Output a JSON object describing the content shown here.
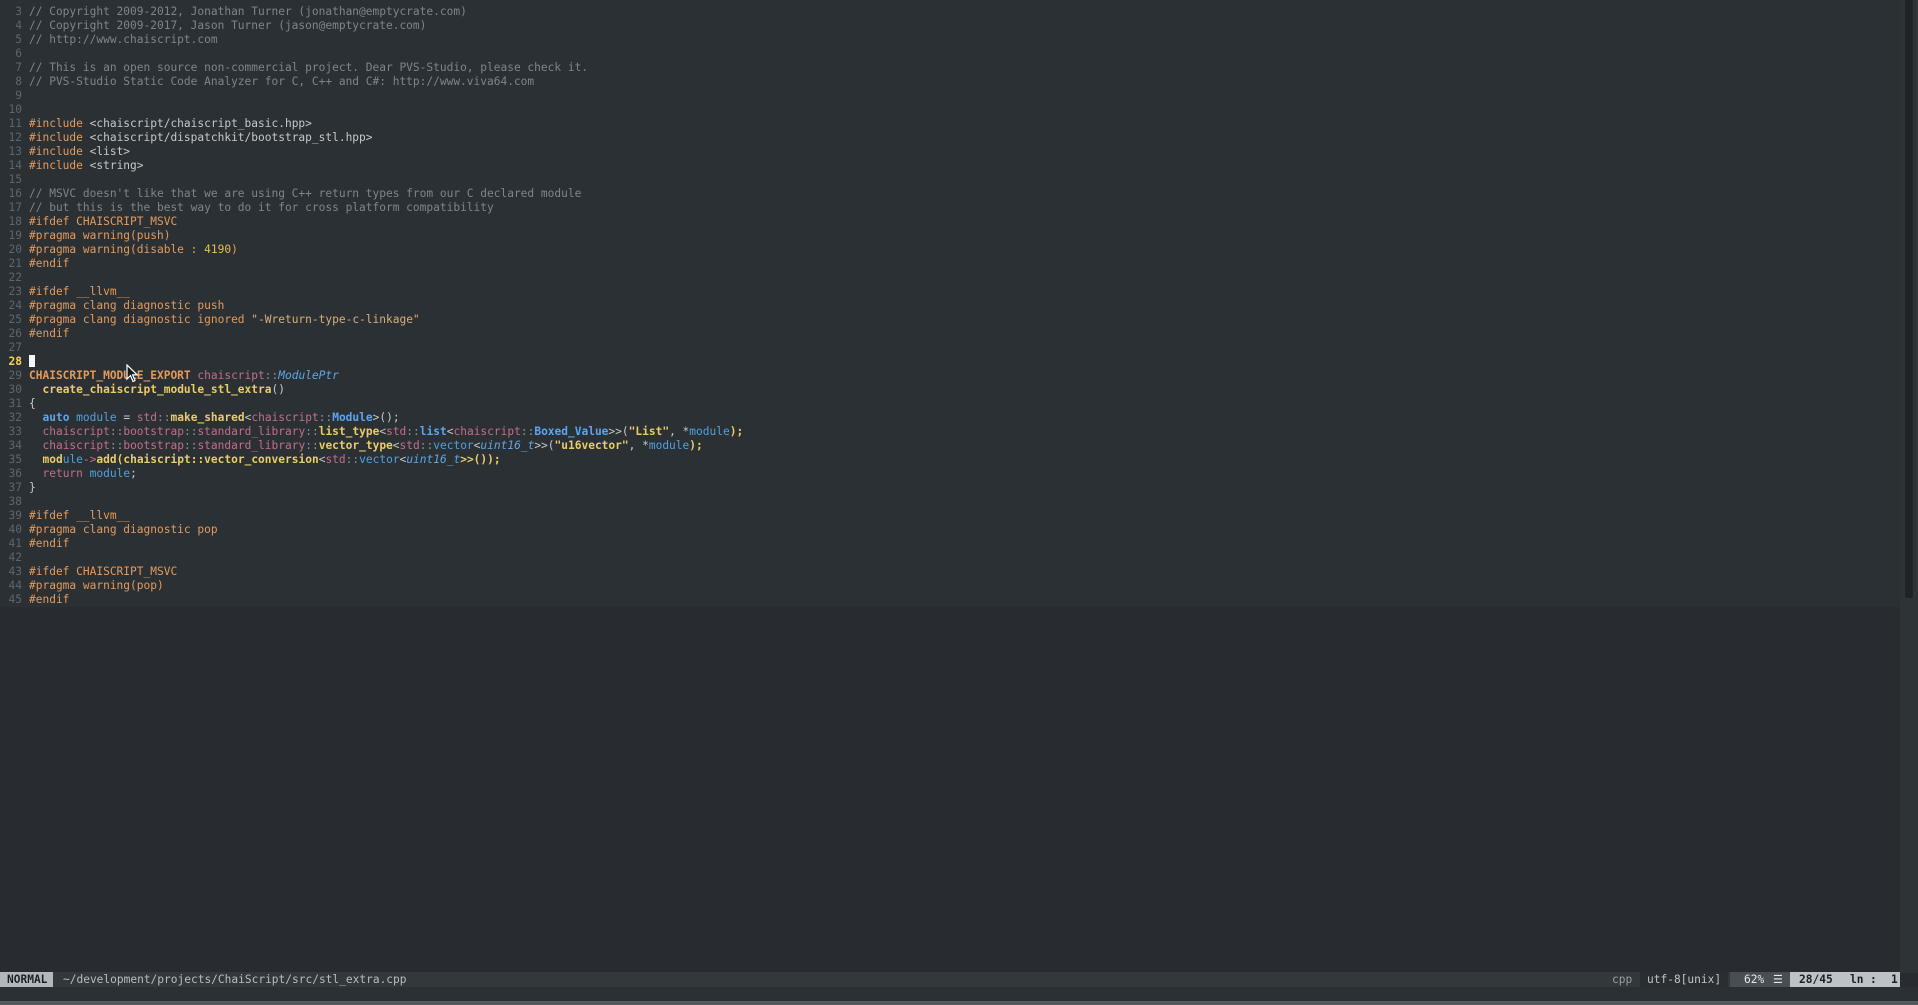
{
  "editor": {
    "lines": [
      {
        "n": "3",
        "tokens": [
          {
            "t": "// Copyright 2009-2012, Jonathan Turner (jonathan@emptycrate.com)",
            "c": "comment"
          }
        ]
      },
      {
        "n": "4",
        "tokens": [
          {
            "t": "// Copyright 2009-2017, Jason Turner (jason@emptycrate.com)",
            "c": "comment"
          }
        ]
      },
      {
        "n": "5",
        "tokens": [
          {
            "t": "// http://www.chaiscript.com",
            "c": "comment"
          }
        ]
      },
      {
        "n": "6",
        "tokens": []
      },
      {
        "n": "7",
        "tokens": [
          {
            "t": "// This is an open source non-commercial project. Dear PVS-Studio, please check it.",
            "c": "comment"
          }
        ]
      },
      {
        "n": "8",
        "tokens": [
          {
            "t": "// PVS-Studio Static Code Analyzer for C, C++ and C#: http://www.viva64.com",
            "c": "comment"
          }
        ]
      },
      {
        "n": "9",
        "tokens": []
      },
      {
        "n": "10",
        "tokens": []
      },
      {
        "n": "11",
        "tokens": [
          {
            "t": "#include ",
            "c": "pp"
          },
          {
            "t": "<chaiscript/chaiscript_basic.hpp>",
            "c": "plain"
          }
        ]
      },
      {
        "n": "12",
        "tokens": [
          {
            "t": "#include ",
            "c": "pp"
          },
          {
            "t": "<chaiscript/dispatchkit/bootstrap_stl.hpp>",
            "c": "plain"
          }
        ]
      },
      {
        "n": "13",
        "tokens": [
          {
            "t": "#include ",
            "c": "pp"
          },
          {
            "t": "<list>",
            "c": "plain"
          }
        ]
      },
      {
        "n": "14",
        "tokens": [
          {
            "t": "#include ",
            "c": "pp"
          },
          {
            "t": "<string>",
            "c": "plain"
          }
        ]
      },
      {
        "n": "15",
        "tokens": []
      },
      {
        "n": "16",
        "tokens": [
          {
            "t": "// MSVC doesn't like that we are using C++ return types from our C declared module",
            "c": "comment"
          }
        ]
      },
      {
        "n": "17",
        "tokens": [
          {
            "t": "// but this is the best way to do it for cross platform compatibility",
            "c": "comment"
          }
        ]
      },
      {
        "n": "18",
        "tokens": [
          {
            "t": "#ifdef CHAISCRIPT_MSVC",
            "c": "pp"
          }
        ]
      },
      {
        "n": "19",
        "tokens": [
          {
            "t": "#pragma warning(push)",
            "c": "pp"
          }
        ]
      },
      {
        "n": "20",
        "tokens": [
          {
            "t": "#pragma warning(disable : ",
            "c": "pp"
          },
          {
            "t": "4190",
            "c": "num"
          },
          {
            "t": ")",
            "c": "pp"
          }
        ]
      },
      {
        "n": "21",
        "tokens": [
          {
            "t": "#endif",
            "c": "pp"
          }
        ]
      },
      {
        "n": "22",
        "tokens": []
      },
      {
        "n": "23",
        "tokens": [
          {
            "t": "#ifdef __llvm__",
            "c": "pp"
          }
        ]
      },
      {
        "n": "24",
        "tokens": [
          {
            "t": "#pragma clang diagnostic push",
            "c": "pp"
          }
        ]
      },
      {
        "n": "25",
        "tokens": [
          {
            "t": "#pragma clang diagnostic ignored ",
            "c": "pp"
          },
          {
            "t": "\"-Wreturn-type-c-linkage\"",
            "c": "str"
          }
        ]
      },
      {
        "n": "26",
        "tokens": [
          {
            "t": "#endif",
            "c": "pp"
          }
        ]
      },
      {
        "n": "27",
        "tokens": []
      },
      {
        "n": "28",
        "current": true,
        "tokens": []
      },
      {
        "n": "29",
        "tokens": [
          {
            "t": "CHAISCRIPT_MODULE_EXPORT ",
            "c": "macro"
          },
          {
            "t": "chaiscript",
            "c": "ns"
          },
          {
            "t": "::",
            "c": "sep"
          },
          {
            "t": "ModulePtr",
            "c": "type"
          }
        ]
      },
      {
        "n": "30",
        "tokens": [
          {
            "t": "  ",
            "c": "plain"
          },
          {
            "t": "create_chaiscript_module_stl_extra",
            "c": "fn"
          },
          {
            "t": "()",
            "c": "plain"
          }
        ]
      },
      {
        "n": "31",
        "tokens": [
          {
            "t": "{",
            "c": "plain"
          }
        ]
      },
      {
        "n": "32",
        "tokens": [
          {
            "t": "  ",
            "c": "plain"
          },
          {
            "t": "auto",
            "c": "kw"
          },
          {
            "t": " module",
            "c": "var"
          },
          {
            "t": " = ",
            "c": "plain"
          },
          {
            "t": "std",
            "c": "ns"
          },
          {
            "t": "::",
            "c": "sep"
          },
          {
            "t": "make_shared",
            "c": "fn"
          },
          {
            "t": "<",
            "c": "plain"
          },
          {
            "t": "chaiscript",
            "c": "ns"
          },
          {
            "t": "::",
            "c": "sep"
          },
          {
            "t": "Module",
            "c": "kw"
          },
          {
            "t": ">();",
            "c": "plain"
          }
        ]
      },
      {
        "n": "33",
        "tokens": [
          {
            "t": "  ",
            "c": "plain"
          },
          {
            "t": "chaiscript",
            "c": "ns"
          },
          {
            "t": "::",
            "c": "sep"
          },
          {
            "t": "bootstrap",
            "c": "ns"
          },
          {
            "t": "::",
            "c": "sep"
          },
          {
            "t": "standard_library",
            "c": "ns"
          },
          {
            "t": "::",
            "c": "sep"
          },
          {
            "t": "list_type",
            "c": "fn"
          },
          {
            "t": "<",
            "c": "plain"
          },
          {
            "t": "std",
            "c": "ns"
          },
          {
            "t": "::",
            "c": "sep"
          },
          {
            "t": "list",
            "c": "kw"
          },
          {
            "t": "<",
            "c": "plain"
          },
          {
            "t": "chaiscript",
            "c": "ns"
          },
          {
            "t": "::",
            "c": "sep"
          },
          {
            "t": "Boxed_Value",
            "c": "kw"
          },
          {
            "t": ">>(",
            "c": "plain"
          },
          {
            "t": "\"List\"",
            "c": "fn"
          },
          {
            "t": ", *",
            "c": "plain"
          },
          {
            "t": "module",
            "c": "var"
          },
          {
            "t": ");",
            "c": "fn"
          }
        ]
      },
      {
        "n": "34",
        "tokens": [
          {
            "t": "  ",
            "c": "plain"
          },
          {
            "t": "chaiscript",
            "c": "ns"
          },
          {
            "t": "::",
            "c": "sep"
          },
          {
            "t": "bootstrap",
            "c": "ns"
          },
          {
            "t": "::",
            "c": "sep"
          },
          {
            "t": "standard_library",
            "c": "ns"
          },
          {
            "t": "::",
            "c": "sep"
          },
          {
            "t": "vector_type",
            "c": "fn"
          },
          {
            "t": "<",
            "c": "plain"
          },
          {
            "t": "std",
            "c": "ns"
          },
          {
            "t": "::",
            "c": "sep"
          },
          {
            "t": "vector",
            "c": "var"
          },
          {
            "t": "<",
            "c": "plain"
          },
          {
            "t": "uint16_t",
            "c": "type"
          },
          {
            "t": ">>(",
            "c": "plain"
          },
          {
            "t": "\"u16vector\"",
            "c": "fn"
          },
          {
            "t": ", *",
            "c": "plain"
          },
          {
            "t": "module",
            "c": "var"
          },
          {
            "t": ");",
            "c": "fn"
          }
        ]
      },
      {
        "n": "35",
        "tokens": [
          {
            "t": "  ",
            "c": "plain"
          },
          {
            "t": "mod",
            "c": "fn"
          },
          {
            "t": "ule",
            "c": "var"
          },
          {
            "t": "->",
            "c": "ns"
          },
          {
            "t": "add(chaiscript::vector_conversion",
            "c": "fn"
          },
          {
            "t": "<",
            "c": "plain"
          },
          {
            "t": "std",
            "c": "ns"
          },
          {
            "t": "::",
            "c": "sep"
          },
          {
            "t": "vector",
            "c": "var"
          },
          {
            "t": "<",
            "c": "plain"
          },
          {
            "t": "uint16_t",
            "c": "type"
          },
          {
            "t": ">>());",
            "c": "fn"
          }
        ]
      },
      {
        "n": "36",
        "tokens": [
          {
            "t": "  ",
            "c": "plain"
          },
          {
            "t": "return",
            "c": "ns"
          },
          {
            "t": " module",
            "c": "var"
          },
          {
            "t": ";",
            "c": "plain"
          }
        ]
      },
      {
        "n": "37",
        "tokens": [
          {
            "t": "}",
            "c": "plain"
          }
        ]
      },
      {
        "n": "38",
        "tokens": []
      },
      {
        "n": "39",
        "tokens": [
          {
            "t": "#ifdef __llvm__",
            "c": "pp"
          }
        ]
      },
      {
        "n": "40",
        "tokens": [
          {
            "t": "#pragma clang diagnostic pop",
            "c": "pp"
          }
        ]
      },
      {
        "n": "41",
        "tokens": [
          {
            "t": "#endif",
            "c": "pp"
          }
        ]
      },
      {
        "n": "42",
        "tokens": []
      },
      {
        "n": "43",
        "tokens": [
          {
            "t": "#ifdef CHAISCRIPT_MSVC",
            "c": "pp"
          }
        ]
      },
      {
        "n": "44",
        "tokens": [
          {
            "t": "#pragma warning(pop)",
            "c": "pp"
          }
        ]
      },
      {
        "n": "45",
        "tokens": [
          {
            "t": "#endif",
            "c": "pp"
          }
        ]
      }
    ]
  },
  "statusbar": {
    "mode": "NORMAL",
    "filepath": "~/development/projects/ChaiScript/src/stl_extra.cpp",
    "filetype": "cpp",
    "encoding": "utf-8[unix]",
    "percent": "62%",
    "lines_icon": "☰",
    "line_info": "28/45",
    "ln_label": "ln",
    "colon": ":",
    "column": "1"
  }
}
